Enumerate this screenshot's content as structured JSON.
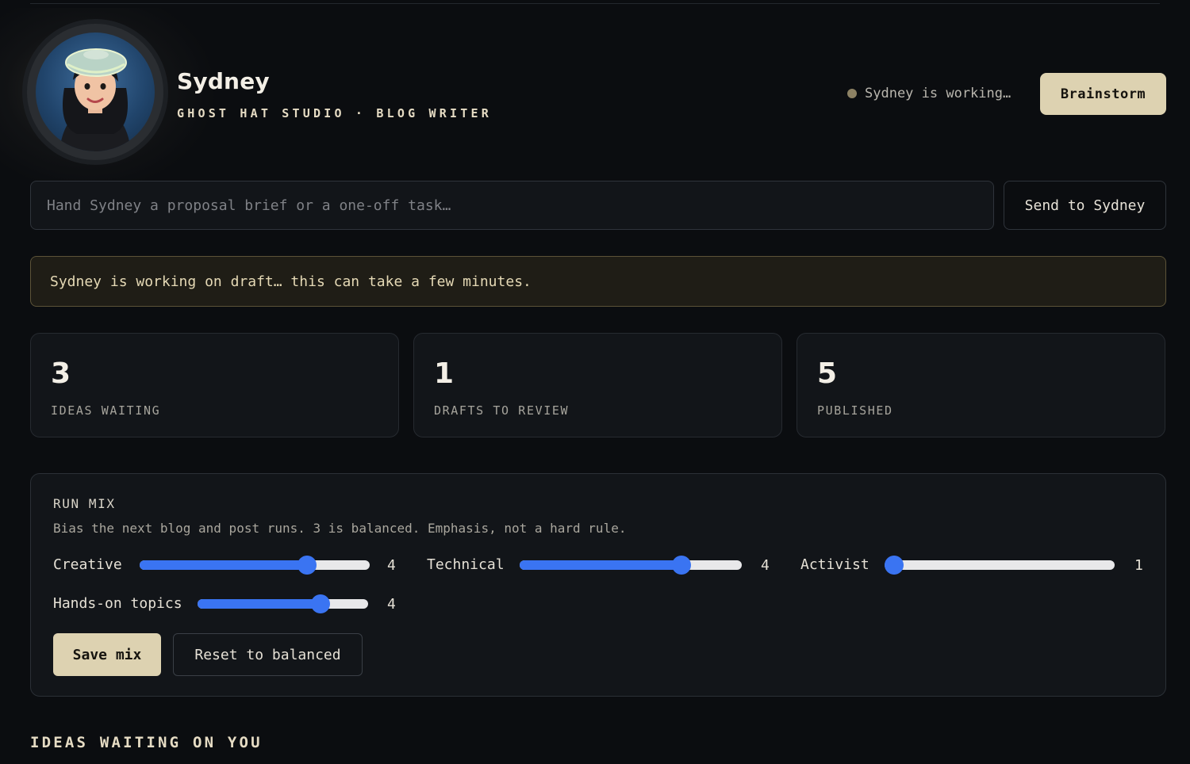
{
  "profile": {
    "name": "Sydney",
    "subtitle": "GHOST HAT STUDIO · BLOG WRITER",
    "status_text": "Sydney is working…",
    "status_color": "#8d8264",
    "primary_action": "Brainstorm"
  },
  "task": {
    "placeholder": "Hand Sydney a proposal brief or a one-off task…",
    "value": "",
    "send_label": "Send to Sydney"
  },
  "banner": {
    "text": "Sydney is working on draft… this can take a few minutes."
  },
  "stats": [
    {
      "value": "3",
      "label": "IDEAS WAITING"
    },
    {
      "value": "1",
      "label": "DRAFTS TO REVIEW"
    },
    {
      "value": "5",
      "label": "PUBLISHED"
    }
  ],
  "run_mix": {
    "title": "RUN MIX",
    "description": "Bias the next blog and post runs. 3 is balanced. Emphasis, not a hard rule.",
    "sliders": [
      {
        "label": "Creative",
        "value": "4",
        "fraction": 0.75
      },
      {
        "label": "Technical",
        "value": "4",
        "fraction": 0.75
      },
      {
        "label": "Activist",
        "value": "1",
        "fraction": 0.0
      },
      {
        "label": "Hands-on topics",
        "value": "4",
        "fraction": 0.75
      }
    ],
    "save_label": "Save mix",
    "reset_label": "Reset to balanced"
  },
  "ideas_section": {
    "title": "IDEAS WAITING ON YOU"
  },
  "colors": {
    "background": "#0b0d10",
    "accent": "#ddd2b1",
    "slider": "#3a74f2",
    "banner_border": "#5c5338"
  }
}
